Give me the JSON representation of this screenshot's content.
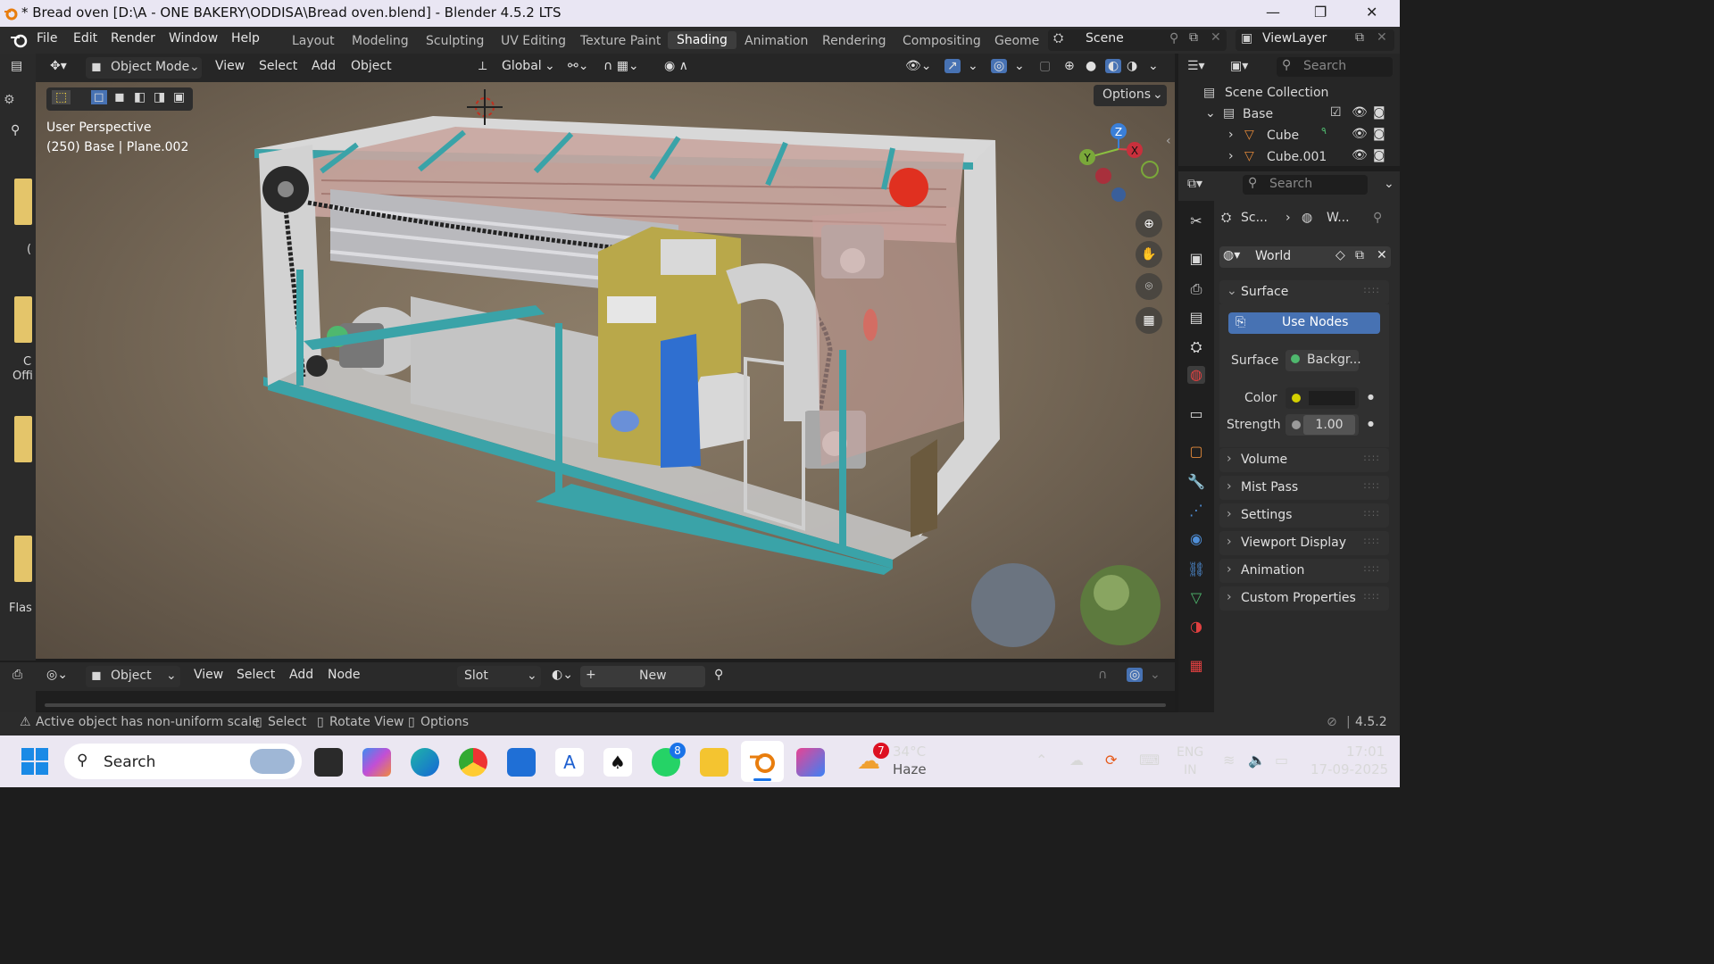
{
  "window": {
    "title": "* Bread oven [D:\\A - ONE BAKERY\\ODDISA\\Bread oven.blend] - Blender 4.5.2 LTS"
  },
  "menu": [
    "File",
    "Edit",
    "Render",
    "Window",
    "Help"
  ],
  "workspaces": [
    "Layout",
    "Modeling",
    "Sculpting",
    "UV Editing",
    "Texture Paint",
    "Shading",
    "Animation",
    "Rendering",
    "Compositing",
    "Geome"
  ],
  "active_workspace": "Shading",
  "scene": {
    "name": "Scene",
    "view_layer": "ViewLayer"
  },
  "viewport_header": {
    "mode": "Object Mode",
    "view": "View",
    "select": "Select",
    "add": "Add",
    "object": "Object",
    "orientation": "Global",
    "options": "Options"
  },
  "viewport_info": {
    "line1": "User Perspective",
    "line2": "(250) Base | Plane.002"
  },
  "gizmo": {
    "x": "X",
    "y": "Y",
    "z": "Z"
  },
  "outliner": {
    "search_placeholder": "Search",
    "root": "Scene Collection",
    "collection": "Base",
    "items": [
      "Cube",
      "Cube.001"
    ]
  },
  "properties": {
    "search_placeholder": "Search",
    "breadcrumb_scene": "Sc...",
    "breadcrumb_world": "W...",
    "world_name": "World",
    "surface_panel": "Surface",
    "use_nodes": "Use Nodes",
    "surface_label": "Surface",
    "surface_value": "Backgr...",
    "color_label": "Color",
    "strength_label": "Strength",
    "strength_value": "1.00",
    "panels": [
      "Volume",
      "Mist Pass",
      "Settings",
      "Viewport Display",
      "Animation",
      "Custom Properties"
    ]
  },
  "shader_header": {
    "editor": "Object",
    "view": "View",
    "select": "Select",
    "add": "Add",
    "node": "Node",
    "slot": "Slot",
    "new": "New"
  },
  "status": {
    "warning": "Active object has non-uniform scale",
    "select": "Select",
    "rotate": "Rotate View",
    "options": "Options",
    "version": "4.5.2"
  },
  "left_partial": {
    "a": "C",
    "b": "Offi",
    "c": "Flas"
  },
  "taskbar": {
    "search": "Search",
    "weather_temp": "34°C",
    "weather_desc": "Haze",
    "weather_badge": "7",
    "whatsapp_badge": "8",
    "lang1": "ENG",
    "lang2": "IN",
    "time": "17:01",
    "date": "17-09-2025"
  },
  "colors": {
    "accent": "#4772b3",
    "frame_teal": "#3aa3a8",
    "panel_yellow": "#b9a84a",
    "blue_box": "#2f6fd0",
    "red_gear": "#e03020",
    "selected_tab": "#3d3d3d"
  }
}
